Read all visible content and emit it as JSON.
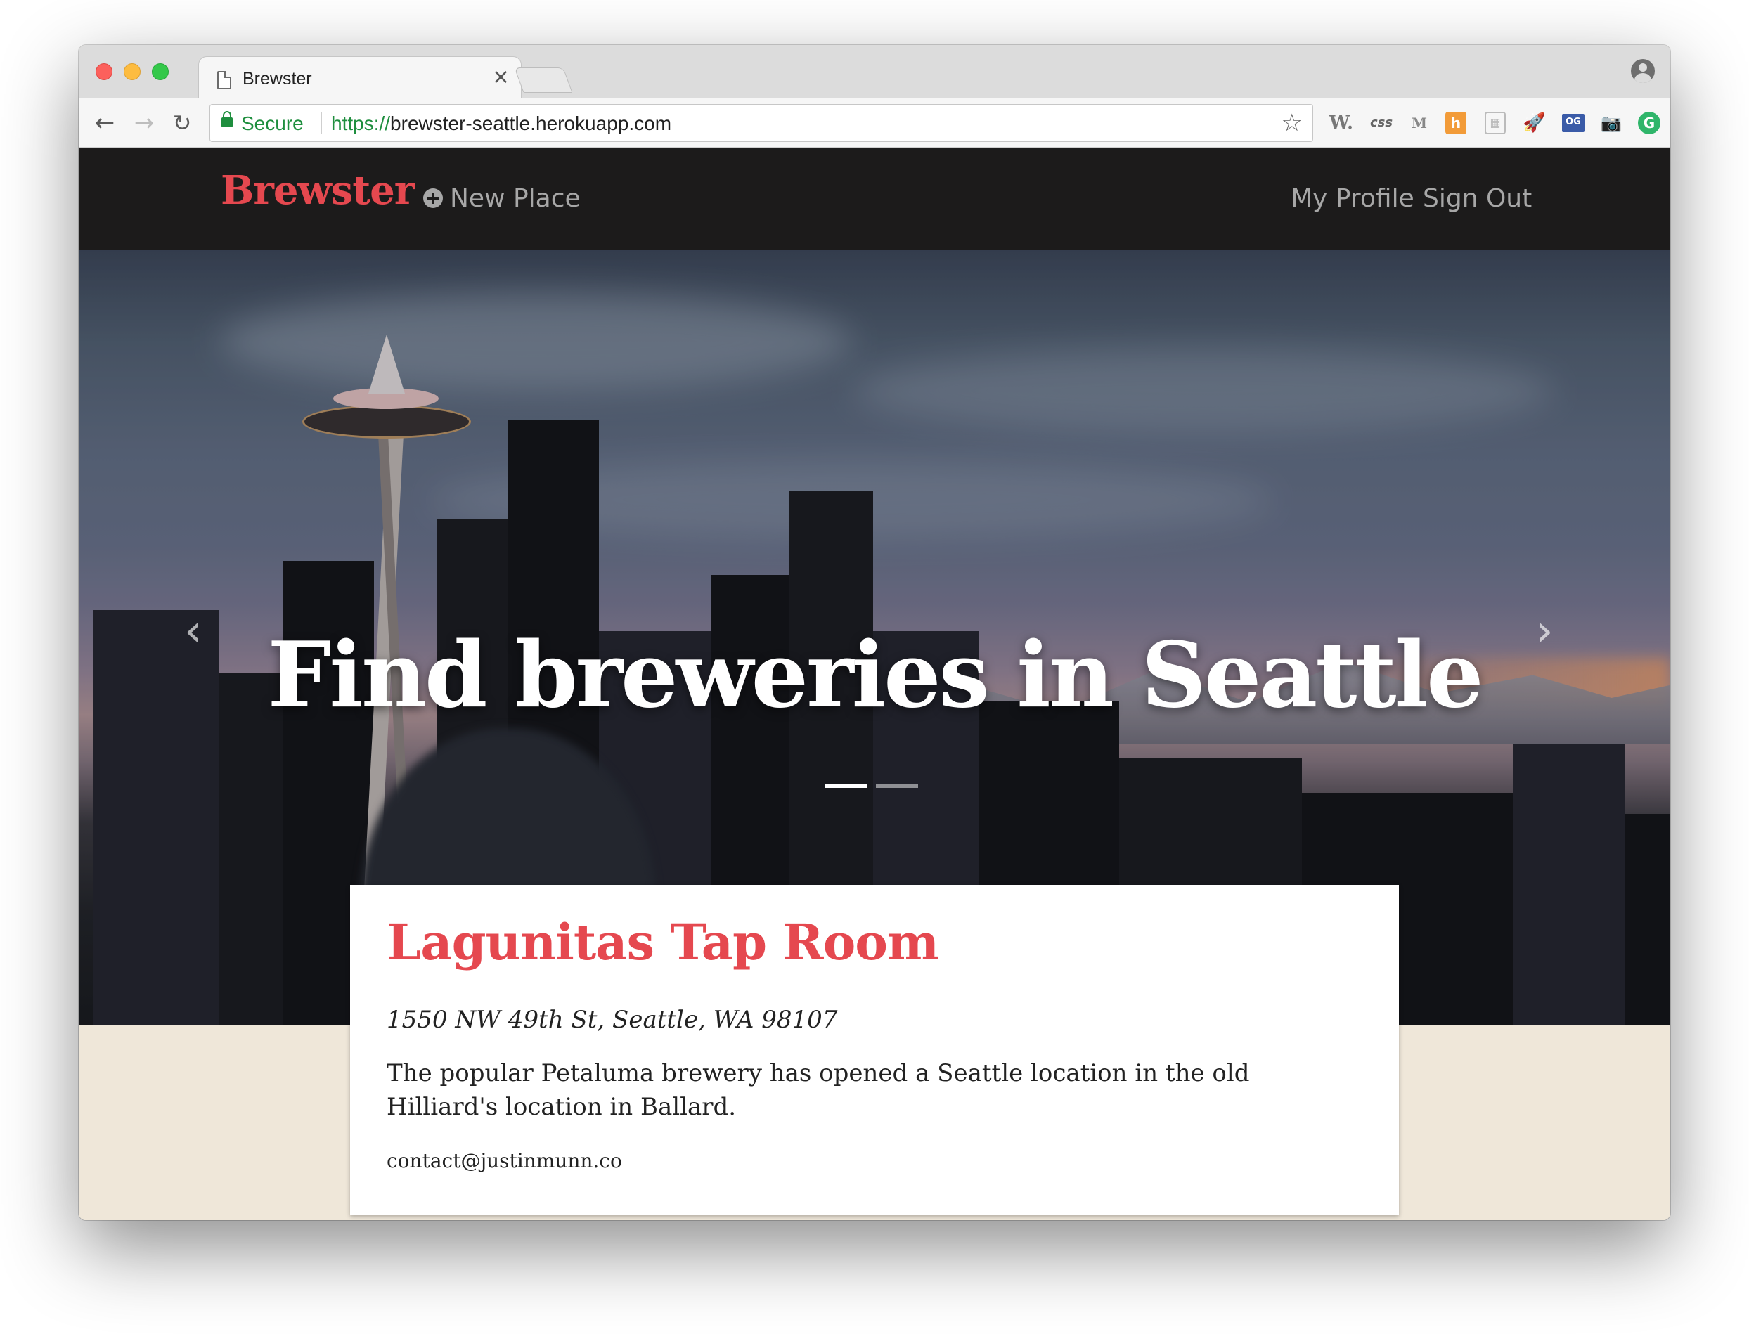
{
  "browser": {
    "tab_title": "Brewster",
    "tab_close": "×",
    "secure_label": "Secure",
    "url_scheme": "https://",
    "url_host": "brewster-seattle.herokuapp.com",
    "extensions": [
      "W.",
      "css",
      "M",
      "h",
      "▦",
      "🚀",
      "OG",
      "📷",
      "G",
      "⬆"
    ]
  },
  "site": {
    "brand": "Brewster",
    "new_place": "New Place",
    "my_profile": "My Profile",
    "sign_out": "Sign Out"
  },
  "hero": {
    "title": "Find breweries in Seattle",
    "prev_arrow": "‹",
    "next_arrow": "›",
    "slides": 2,
    "active_slide": 0
  },
  "place": {
    "name": "Lagunitas Tap Room",
    "address": "1550 NW 49th St, Seattle, WA 98107",
    "description": "The popular Petaluma brewery has opened a Seattle location in the old Hilliard's location in Ballard.",
    "contact": "contact@justinmunn.co"
  },
  "colors": {
    "brand_red": "#e5484f",
    "nav_bg": "#1c1b1b",
    "page_bg": "#efe7d9",
    "secure_green": "#1e8e3e"
  }
}
